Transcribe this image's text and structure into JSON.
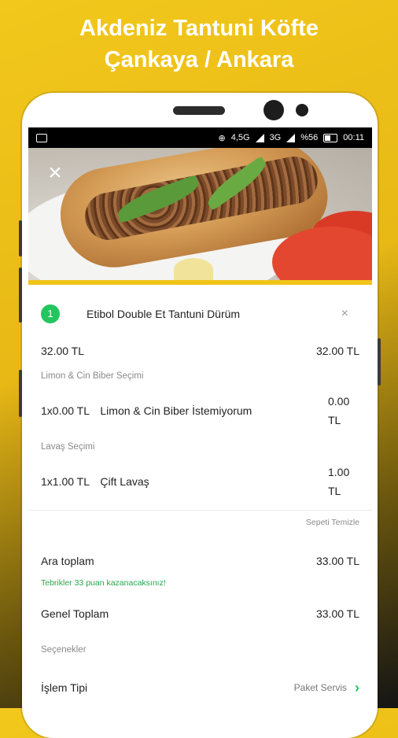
{
  "banner": {
    "line1": "Akdeniz Tantuni Köfte",
    "line2": "Çankaya / Ankara"
  },
  "statusbar": {
    "net1": "4,5G",
    "net2": "3G",
    "battery": "%56",
    "time": "00:11"
  },
  "hero": {
    "close_icon": "close-icon"
  },
  "cart": {
    "item": {
      "qty": "1",
      "name": "Etibol Double Et Tantuni Dürüm",
      "unit_price": "32.00 TL",
      "total_price": "32.00 TL",
      "remove_label": "×"
    },
    "groups": [
      {
        "label": "Limon & Cin Biber Seçimi",
        "option_qty_price": "1x0.00 TL",
        "option_name": "Limon & Cin Biber İstemiyorum",
        "option_total_a": "0.00",
        "option_total_b": "TL"
      },
      {
        "label": "Lavaş Seçimi",
        "option_qty_price": "1x1.00 TL",
        "option_name": "Çift Lavaş",
        "option_total_a": "1.00",
        "option_total_b": "TL"
      }
    ],
    "clear_label": "Sepeti Temizle"
  },
  "summary": {
    "subtotal_label": "Ara toplam",
    "subtotal_value": "33.00 TL",
    "promo": "Tebrikler 33 puan kazanacaksınız!",
    "grand_label": "Genel Toplam",
    "grand_value": "33.00 TL",
    "options_label": "Seçenekler",
    "op_type_label": "İşlem Tipi",
    "op_type_value": "Paket Servis"
  },
  "colors": {
    "accent": "#22c55e",
    "brand_yellow": "#f0c419"
  }
}
